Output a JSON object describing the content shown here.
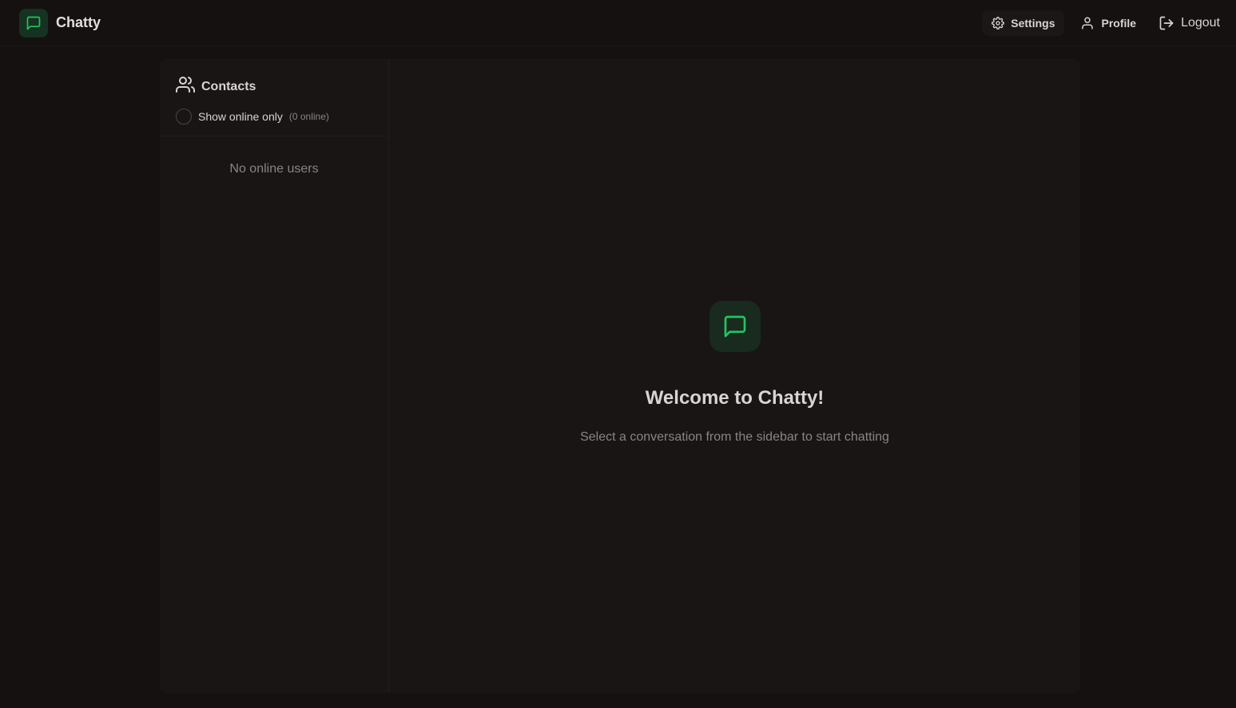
{
  "app": {
    "name": "Chatty",
    "accent_color": "#22c55e"
  },
  "nav": {
    "settings_label": "Settings",
    "profile_label": "Profile",
    "logout_label": "Logout"
  },
  "sidebar": {
    "title": "Contacts",
    "filter_label": "Show online only",
    "online_count": "(0 online)",
    "empty_text": "No online users"
  },
  "welcome": {
    "title": "Welcome to Chatty!",
    "subtitle": "Select a conversation from the sidebar to start chatting"
  },
  "icons": {
    "logo": "message-square-icon",
    "settings": "gear-icon",
    "profile": "user-icon",
    "logout": "logout-icon",
    "contacts": "users-icon"
  }
}
